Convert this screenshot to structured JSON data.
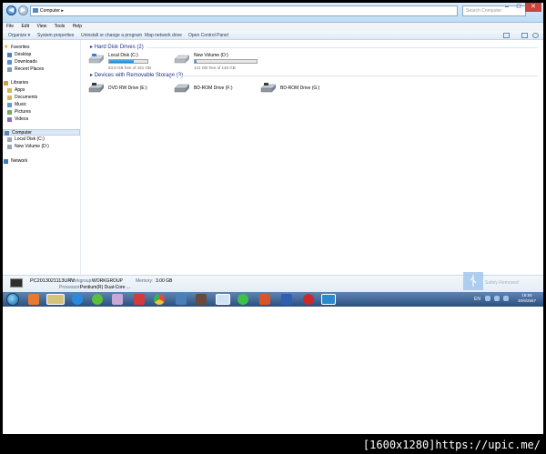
{
  "address": {
    "path": "Computer",
    "search_placeholder": "Search Computer"
  },
  "menu": [
    "File",
    "Edit",
    "View",
    "Tools",
    "Help"
  ],
  "toolbar": {
    "organize": "Organize ▾",
    "system_properties": "System properties",
    "uninstall": "Uninstall or change a program",
    "map_drive": "Map network drive",
    "control_panel": "Open Control Panel"
  },
  "nav": {
    "favorites": "Favorites",
    "desktop": "Desktop",
    "downloads": "Downloads",
    "recent": "Recent Places",
    "libraries": "Libraries",
    "apps": "Apps",
    "documents": "Documents",
    "music": "Music",
    "pictures": "Pictures",
    "videos": "Videos",
    "computer": "Computer",
    "local_c": "Local Disk (C:)",
    "new_d": "New Volume (D:)",
    "network": "Network"
  },
  "groups": {
    "hdd": "Hard Disk Drives (2)",
    "removable": "Devices with Removable Storage (3)"
  },
  "drives": [
    {
      "label": "Local Disk (C:)",
      "free": "53.8 GB free of 151 GB",
      "used_fraction": 0.64
    },
    {
      "label": "New Volume (D:)",
      "free": "141 GB free of 146 GB",
      "used_fraction": 0.03
    }
  ],
  "removable": [
    {
      "label": "DVD RW Drive (E:)"
    },
    {
      "label": "BD-ROM Drive (F:)"
    },
    {
      "label": "BD-ROM Drive (G:)"
    }
  ],
  "details": {
    "name": "PC2013021113URV",
    "workgroup_label": "Workgroup:",
    "workgroup": "WORKGROUP",
    "memory_label": "Memory:",
    "memory": "3.00 GB",
    "processor_label": "Processor:",
    "processor": "Pentium(R) Dual-Core ..."
  },
  "notification": "Safely Removed",
  "tray": {
    "lang": "EN",
    "time": "18:55",
    "date": "30/9/2557"
  },
  "watermark": "[1600x1280]https://upic.me/",
  "colors": {
    "accent": "#1e3287",
    "bar_fill": "#1c84cc",
    "taskbar": "#2b4f7e"
  }
}
